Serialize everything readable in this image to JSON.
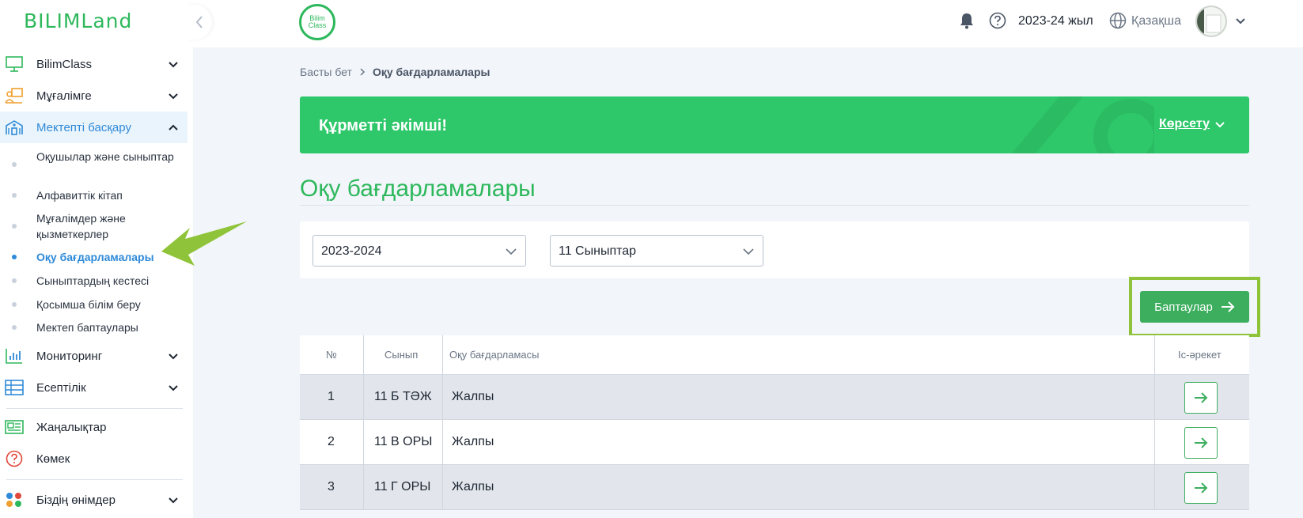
{
  "sidebar": {
    "logo": "BILIMLand",
    "items": [
      {
        "label": "BilimClass",
        "icon": "monitor-icon"
      },
      {
        "label": "Мұғалімге",
        "icon": "teacher-icon"
      },
      {
        "label": "Мектепті басқару",
        "icon": "school-icon"
      },
      {
        "label": "Мониторинг",
        "icon": "chart-icon"
      },
      {
        "label": "Есептілік",
        "icon": "table-icon"
      },
      {
        "label": "Жаңалықтар",
        "icon": "news-icon"
      },
      {
        "label": "Көмек",
        "icon": "help-circle-icon"
      },
      {
        "label": "Біздің өнімдер",
        "icon": "products-icon"
      }
    ],
    "sub_items": [
      {
        "label": "Оқушылар және сыныптар"
      },
      {
        "label": "Алфавиттік кітап"
      },
      {
        "label": "Мұғалімдер және қызметкерлер"
      },
      {
        "label": "Оқу бағдарламалары"
      },
      {
        "label": "Сыныптардың кестесі"
      },
      {
        "label": "Қосымша білім беру"
      },
      {
        "label": "Мектеп баптаулары"
      }
    ]
  },
  "header": {
    "app_logo_line1": "Bilim",
    "app_logo_line2": "Class",
    "year": "2023-24 жыл",
    "language": "Қазақша"
  },
  "breadcrumb": {
    "home": "Басты бет",
    "current": "Оқу бағдарламалары"
  },
  "banner": {
    "title": "Құрметті әкімші!",
    "show_label": "Көрсету"
  },
  "page_title": "Оқу бағдарламалары",
  "filters": {
    "year_value": "2023-2024",
    "grade_value": "11 Сыныптар"
  },
  "settings_button": "Баптаулар",
  "table": {
    "headers": [
      "№",
      "Сынып",
      "Оқу бағдарламасы",
      "Іс-әрекет"
    ],
    "rows": [
      {
        "num": "1",
        "class": "11 Б ТӘЖ",
        "program": "Жалпы"
      },
      {
        "num": "2",
        "class": "11 В ОРЫ",
        "program": "Жалпы"
      },
      {
        "num": "3",
        "class": "11 Г ОРЫ",
        "program": "Жалпы"
      }
    ]
  },
  "colors": {
    "brand_green": "#2eb85c",
    "accent_blue": "#2e8ad8",
    "annotation_green": "#8fc43a"
  }
}
